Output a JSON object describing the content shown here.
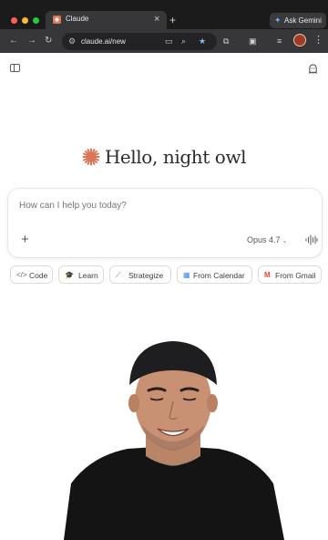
{
  "browser": {
    "tab_title": "Claude",
    "tab_close": "×",
    "new_tab": "+",
    "url": "claude.ai/new",
    "ask_gemini": "Ask Gemini",
    "back_icon": "←",
    "forward_icon": "→",
    "reload_icon": "↻",
    "menu_icon": "⋮"
  },
  "page": {
    "greeting": "Hello, night owl",
    "composer": {
      "placeholder": "How can I help you today?",
      "add_label": "+",
      "model": "Opus 4.7",
      "model_chevron": "⌄"
    },
    "chips": [
      {
        "icon": "</>",
        "label": "Code"
      },
      {
        "icon": "🎓",
        "label": "Learn"
      },
      {
        "icon": "⟋",
        "label": "Strategize"
      },
      {
        "icon": "▦",
        "label": "From Calendar"
      },
      {
        "icon": "M",
        "label": "From Gmail"
      }
    ]
  },
  "colors": {
    "brand_spark": "#d97757",
    "chrome_dark": "#1b1b1c",
    "toolbar": "#37373a",
    "star": "#8ab4f8"
  }
}
